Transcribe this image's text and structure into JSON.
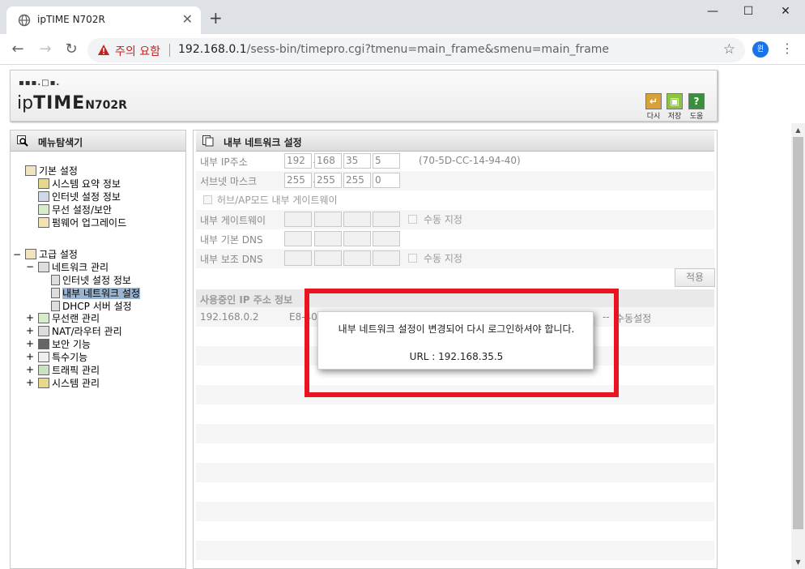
{
  "browser": {
    "tab_title": "ipTIME N702R",
    "new_tab": "+",
    "warning": "주의 요함",
    "url_host": "192.168.0.1",
    "url_path": "/sess-bin/timepro.cgi?tmenu=main_frame&smenu=main_frame",
    "profile_initial": "윈"
  },
  "header": {
    "logo_dots": "▪▪▪.□▪.",
    "logo_ip": "ip",
    "logo_time": "TIME",
    "logo_model": "N702R",
    "buttons": [
      {
        "label": "다시",
        "icon": "refresh-icon",
        "color": "#d9a13a"
      },
      {
        "label": "저장",
        "icon": "save-icon",
        "color": "#8cc63f"
      },
      {
        "label": "도움",
        "icon": "help-icon",
        "color": "#3a8f3a"
      }
    ]
  },
  "menu": {
    "title": "메뉴탐색기",
    "basic": {
      "label": "기본 설정",
      "items": [
        "시스템 요약 정보",
        "인터넷 설정 정보",
        "무선 설정/보안",
        "펌웨어 업그레이드"
      ]
    },
    "advanced": {
      "label": "고급 설정",
      "network": {
        "label": "네트워크 관리",
        "items": [
          "인터넷 설정 정보",
          "내부 네트워크 설정",
          "DHCP 서버 설정"
        ]
      },
      "others": [
        "무선랜 관리",
        "NAT/라우터 관리",
        "보안 기능",
        "특수기능",
        "트래픽 관리",
        "시스템 관리"
      ]
    }
  },
  "content": {
    "title": "내부 네트워크 설정",
    "ip_label": "내부 IP주소",
    "ip": [
      "192",
      "168",
      "35",
      "5"
    ],
    "mac": "(70-5D-CC-14-94-40)",
    "subnet_label": "서브넷 마스크",
    "subnet": [
      "255",
      "255",
      "255",
      "0"
    ],
    "hub_ap_label": "허브/AP모드 내부 게이트웨이",
    "gateway_label": "내부 게이트웨이",
    "dns1_label": "내부 기본 DNS",
    "dns2_label": "내부 보조 DNS",
    "manual_label": "수동 지정",
    "apply_label": "적용",
    "ip_info_title": "사용중인 IP 주소 정보",
    "ip_info_rows": [
      {
        "ip": "192.168.0.2",
        "mac": "E8-40-",
        "status": "--",
        "mode": "수동설정"
      }
    ]
  },
  "popup": {
    "message": "내부 네트워크 설정이 변경되어 다시 로그인하셔야 합니다.",
    "url": "URL : 192.168.35.5"
  }
}
